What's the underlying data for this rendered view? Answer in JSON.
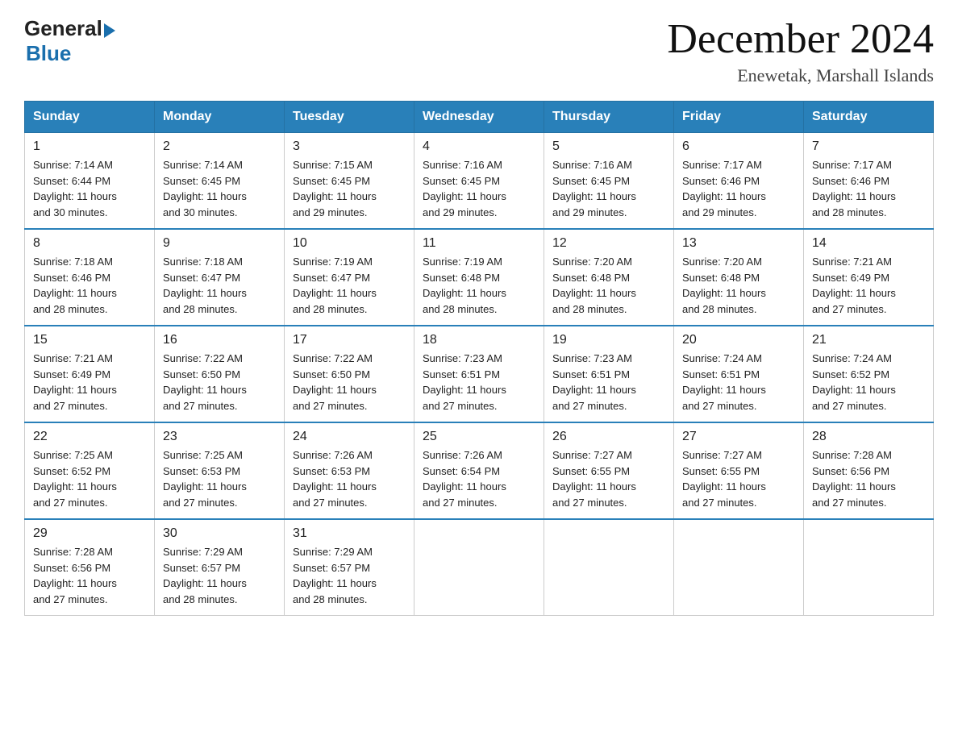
{
  "logo": {
    "general": "General",
    "blue": "Blue"
  },
  "title": "December 2024",
  "subtitle": "Enewetak, Marshall Islands",
  "days_of_week": [
    "Sunday",
    "Monday",
    "Tuesday",
    "Wednesday",
    "Thursday",
    "Friday",
    "Saturday"
  ],
  "weeks": [
    [
      {
        "day": "1",
        "sunrise": "7:14 AM",
        "sunset": "6:44 PM",
        "daylight": "11 hours and 30 minutes."
      },
      {
        "day": "2",
        "sunrise": "7:14 AM",
        "sunset": "6:45 PM",
        "daylight": "11 hours and 30 minutes."
      },
      {
        "day": "3",
        "sunrise": "7:15 AM",
        "sunset": "6:45 PM",
        "daylight": "11 hours and 29 minutes."
      },
      {
        "day": "4",
        "sunrise": "7:16 AM",
        "sunset": "6:45 PM",
        "daylight": "11 hours and 29 minutes."
      },
      {
        "day": "5",
        "sunrise": "7:16 AM",
        "sunset": "6:45 PM",
        "daylight": "11 hours and 29 minutes."
      },
      {
        "day": "6",
        "sunrise": "7:17 AM",
        "sunset": "6:46 PM",
        "daylight": "11 hours and 29 minutes."
      },
      {
        "day": "7",
        "sunrise": "7:17 AM",
        "sunset": "6:46 PM",
        "daylight": "11 hours and 28 minutes."
      }
    ],
    [
      {
        "day": "8",
        "sunrise": "7:18 AM",
        "sunset": "6:46 PM",
        "daylight": "11 hours and 28 minutes."
      },
      {
        "day": "9",
        "sunrise": "7:18 AM",
        "sunset": "6:47 PM",
        "daylight": "11 hours and 28 minutes."
      },
      {
        "day": "10",
        "sunrise": "7:19 AM",
        "sunset": "6:47 PM",
        "daylight": "11 hours and 28 minutes."
      },
      {
        "day": "11",
        "sunrise": "7:19 AM",
        "sunset": "6:48 PM",
        "daylight": "11 hours and 28 minutes."
      },
      {
        "day": "12",
        "sunrise": "7:20 AM",
        "sunset": "6:48 PM",
        "daylight": "11 hours and 28 minutes."
      },
      {
        "day": "13",
        "sunrise": "7:20 AM",
        "sunset": "6:48 PM",
        "daylight": "11 hours and 28 minutes."
      },
      {
        "day": "14",
        "sunrise": "7:21 AM",
        "sunset": "6:49 PM",
        "daylight": "11 hours and 27 minutes."
      }
    ],
    [
      {
        "day": "15",
        "sunrise": "7:21 AM",
        "sunset": "6:49 PM",
        "daylight": "11 hours and 27 minutes."
      },
      {
        "day": "16",
        "sunrise": "7:22 AM",
        "sunset": "6:50 PM",
        "daylight": "11 hours and 27 minutes."
      },
      {
        "day": "17",
        "sunrise": "7:22 AM",
        "sunset": "6:50 PM",
        "daylight": "11 hours and 27 minutes."
      },
      {
        "day": "18",
        "sunrise": "7:23 AM",
        "sunset": "6:51 PM",
        "daylight": "11 hours and 27 minutes."
      },
      {
        "day": "19",
        "sunrise": "7:23 AM",
        "sunset": "6:51 PM",
        "daylight": "11 hours and 27 minutes."
      },
      {
        "day": "20",
        "sunrise": "7:24 AM",
        "sunset": "6:51 PM",
        "daylight": "11 hours and 27 minutes."
      },
      {
        "day": "21",
        "sunrise": "7:24 AM",
        "sunset": "6:52 PM",
        "daylight": "11 hours and 27 minutes."
      }
    ],
    [
      {
        "day": "22",
        "sunrise": "7:25 AM",
        "sunset": "6:52 PM",
        "daylight": "11 hours and 27 minutes."
      },
      {
        "day": "23",
        "sunrise": "7:25 AM",
        "sunset": "6:53 PM",
        "daylight": "11 hours and 27 minutes."
      },
      {
        "day": "24",
        "sunrise": "7:26 AM",
        "sunset": "6:53 PM",
        "daylight": "11 hours and 27 minutes."
      },
      {
        "day": "25",
        "sunrise": "7:26 AM",
        "sunset": "6:54 PM",
        "daylight": "11 hours and 27 minutes."
      },
      {
        "day": "26",
        "sunrise": "7:27 AM",
        "sunset": "6:55 PM",
        "daylight": "11 hours and 27 minutes."
      },
      {
        "day": "27",
        "sunrise": "7:27 AM",
        "sunset": "6:55 PM",
        "daylight": "11 hours and 27 minutes."
      },
      {
        "day": "28",
        "sunrise": "7:28 AM",
        "sunset": "6:56 PM",
        "daylight": "11 hours and 27 minutes."
      }
    ],
    [
      {
        "day": "29",
        "sunrise": "7:28 AM",
        "sunset": "6:56 PM",
        "daylight": "11 hours and 27 minutes."
      },
      {
        "day": "30",
        "sunrise": "7:29 AM",
        "sunset": "6:57 PM",
        "daylight": "11 hours and 28 minutes."
      },
      {
        "day": "31",
        "sunrise": "7:29 AM",
        "sunset": "6:57 PM",
        "daylight": "11 hours and 28 minutes."
      },
      null,
      null,
      null,
      null
    ]
  ],
  "labels": {
    "sunrise": "Sunrise:",
    "sunset": "Sunset:",
    "daylight": "Daylight:"
  }
}
